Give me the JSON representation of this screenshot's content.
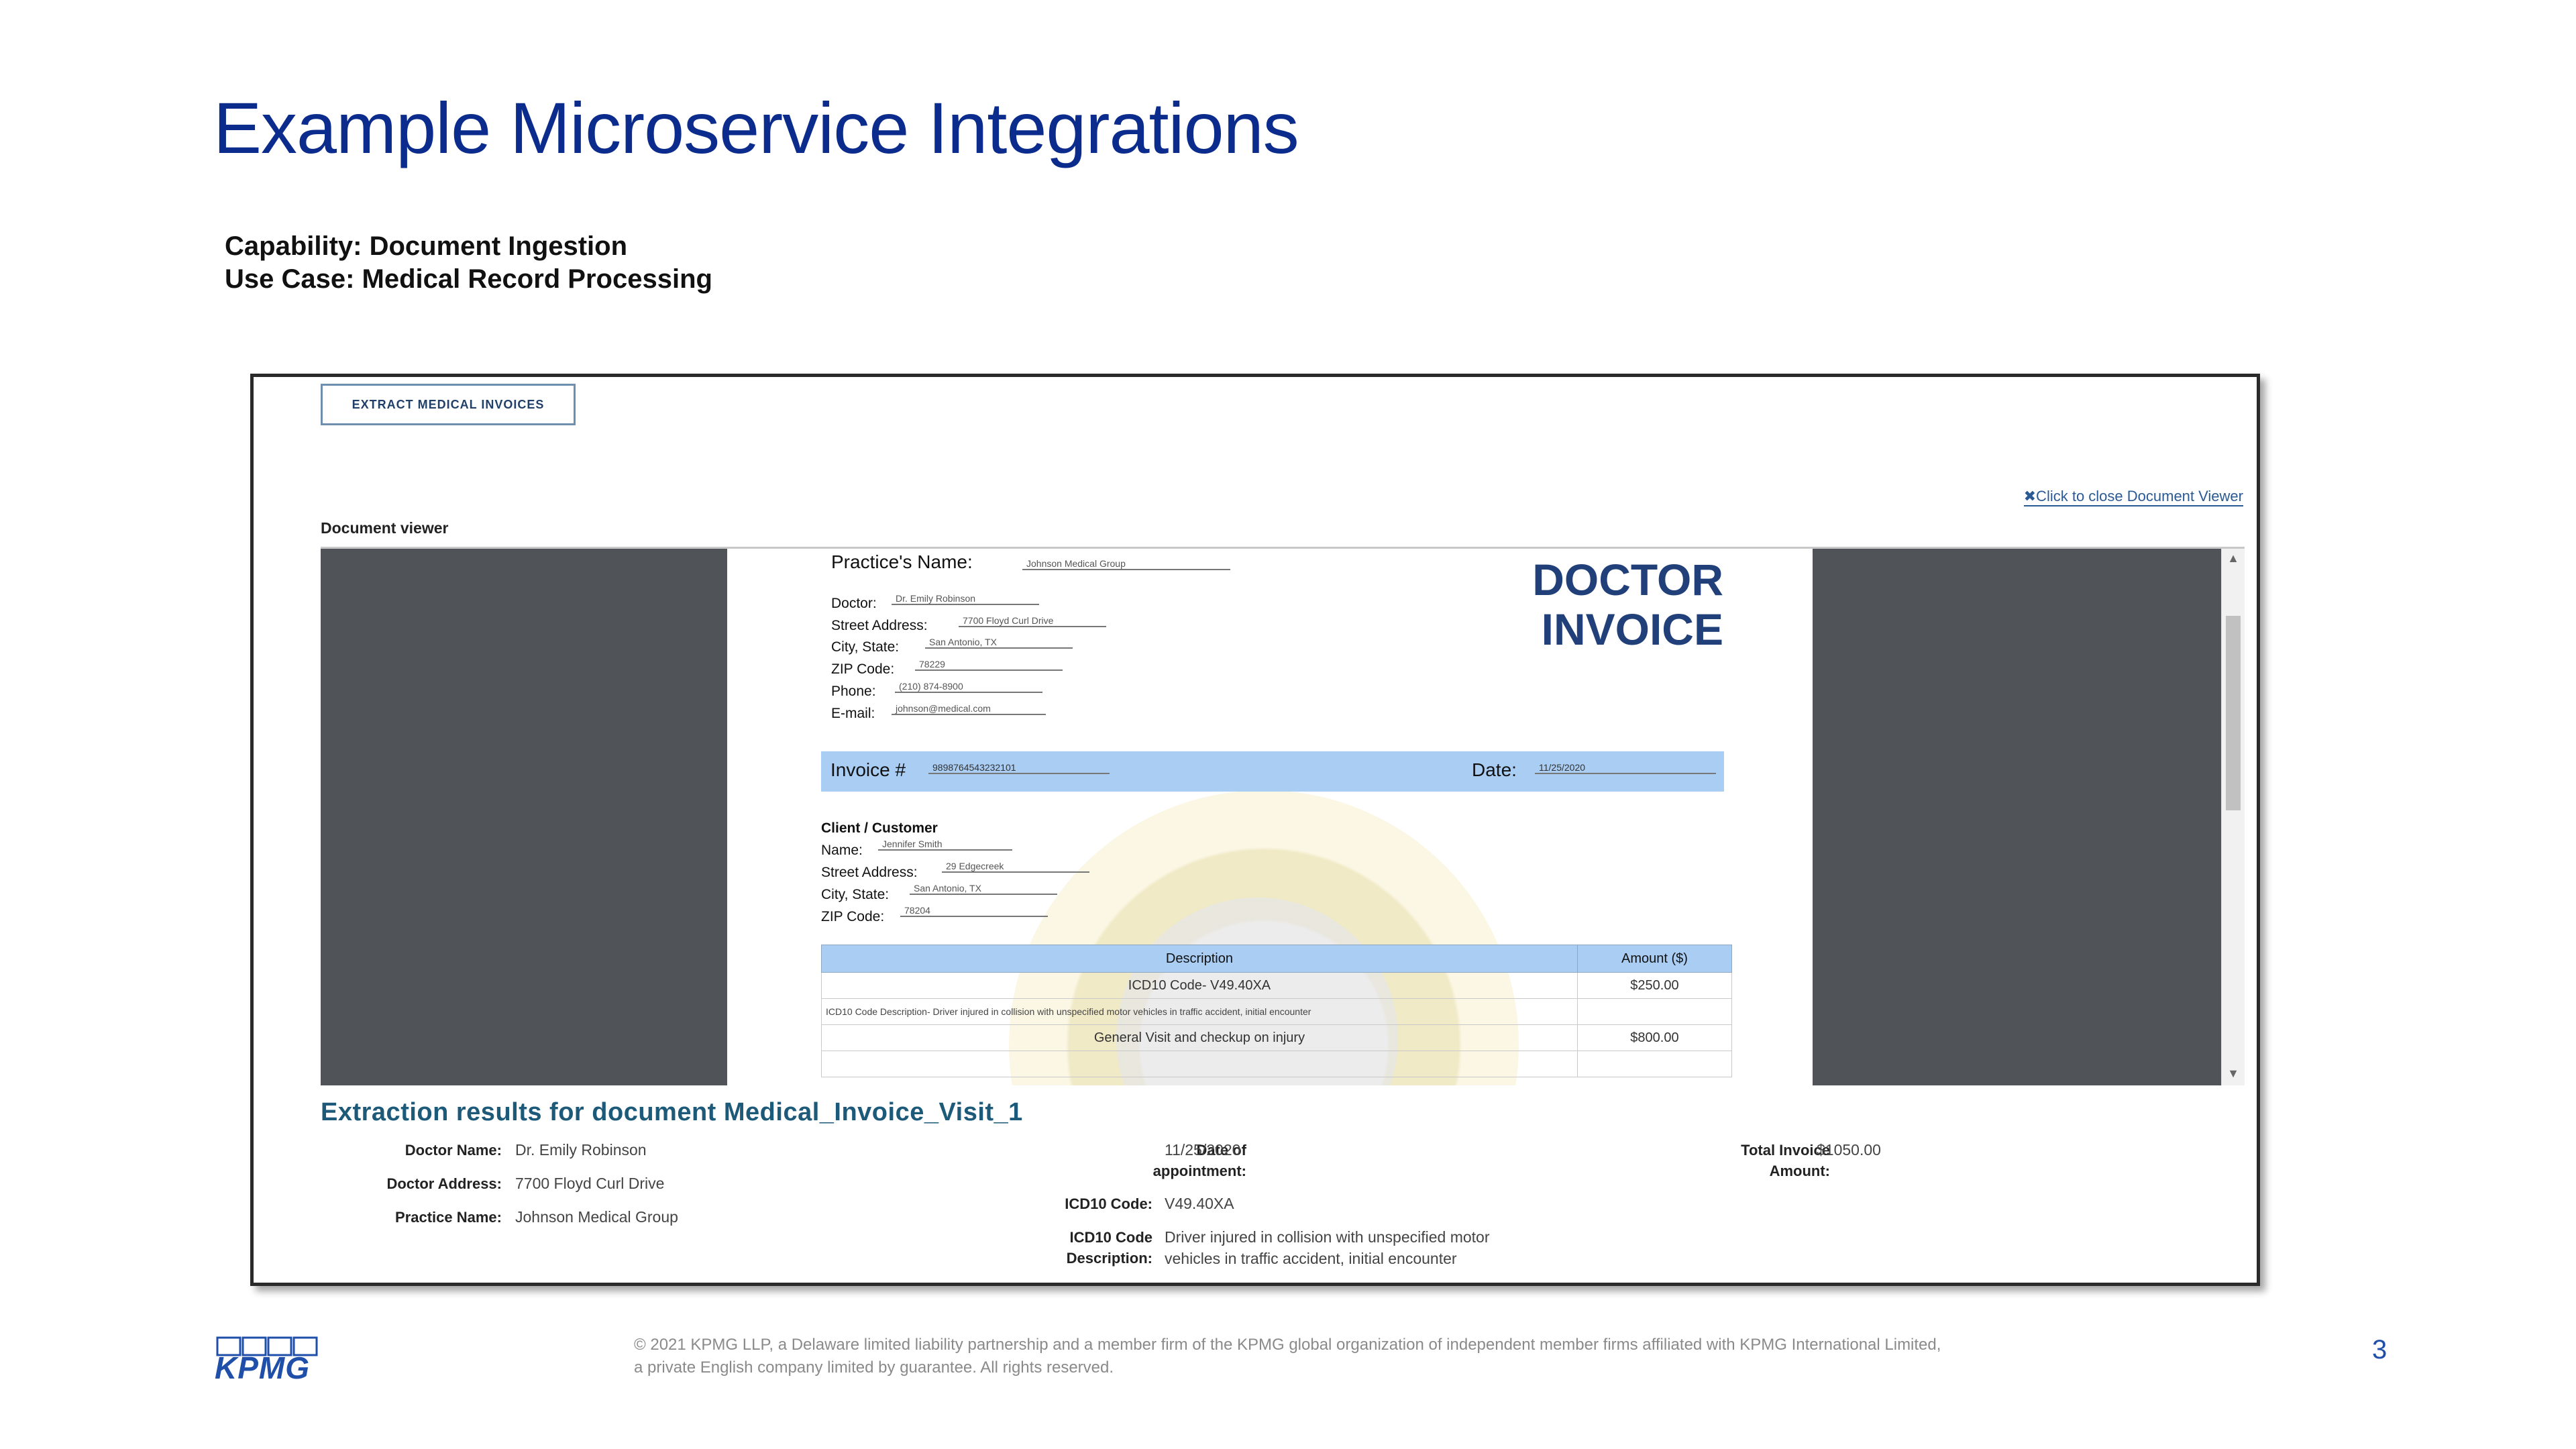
{
  "slide": {
    "title": "Example Microservice Integrations",
    "capability": "Capability: Document Ingestion",
    "use_case": "Use Case: Medical Record Processing"
  },
  "app": {
    "extract_button": "EXTRACT MEDICAL INVOICES",
    "close_viewer": "✖Click to close Document Viewer",
    "viewer_label": "Document viewer"
  },
  "invoice": {
    "heading_line1": "DOCTOR",
    "heading_line2": "INVOICE",
    "practice_label": "Practice's Name:",
    "practice_value": "Johnson Medical Group",
    "doctor_label": "Doctor:",
    "doctor_value": "Dr. Emily Robinson",
    "street_label": "Street Address:",
    "street_value": "7700 Floyd Curl Drive",
    "city_label": "City, State:",
    "city_value": "San Antonio, TX",
    "zip_label": "ZIP Code:",
    "zip_value": "78229",
    "phone_label": "Phone:",
    "phone_value": "(210) 874-8900",
    "email_label": "E-mail:",
    "email_value": "johnson@medical.com",
    "invoice_label": "Invoice #",
    "invoice_value": "9898764543232101",
    "date_label": "Date:",
    "date_value": "11/25/2020",
    "client_heading": "Client / Customer",
    "client_name_label": "Name:",
    "client_name_value": "Jennifer Smith",
    "client_street_label": "Street Address:",
    "client_street_value": "29 Edgecreek",
    "client_city_label": "City, State:",
    "client_city_value": "San Antonio, TX",
    "client_zip_label": "ZIP Code:",
    "client_zip_value": "78204",
    "table_headers": [
      "Description",
      "Amount ($)"
    ],
    "rows": [
      {
        "description": "ICD10 Code- V49.40XA",
        "amount": "$250.00"
      },
      {
        "description": "ICD10 Code Description- Driver injured in collision with unspecified motor vehicles in traffic accident, initial encounter",
        "amount": ""
      },
      {
        "description": "General Visit and checkup on injury",
        "amount": "$800.00"
      },
      {
        "description": "",
        "amount": ""
      }
    ]
  },
  "results": {
    "title": "Extraction results for document Medical_Invoice_Visit_1",
    "doctor_name_label": "Doctor Name:",
    "doctor_name_value": "Dr. Emily Robinson",
    "doctor_address_label": "Doctor Address:",
    "doctor_address_value": "7700 Floyd Curl Drive",
    "practice_name_label": "Practice Name:",
    "practice_name_value": "Johnson Medical Group",
    "date_label_1": "Date of",
    "date_label_2": "appointment:",
    "date_value": "11/25/2020",
    "icd_code_label": "ICD10 Code:",
    "icd_code_value": "V49.40XA",
    "icd_desc_label_1": "ICD10 Code",
    "icd_desc_label_2": "Description:",
    "icd_desc_value_1": "Driver injured in collision with unspecified motor",
    "icd_desc_value_2": "vehicles in traffic accident, initial encounter",
    "total_label_1": "Total Invoice",
    "total_label_2": "Amount:",
    "total_value": "$1050.00"
  },
  "footer": {
    "copyright_line1": "© 2021 KPMG LLP, a Delaware limited liability partnership and a member firm of the KPMG global organization of independent member firms affiliated with KPMG International Limited,",
    "copyright_line2": "a private English company limited by guarantee. All rights reserved.",
    "page_number": "3",
    "logo_text": "KPMG"
  },
  "colors": {
    "title_blue": "#0b2c8c",
    "invoice_bar": "#a9cdf3",
    "dark_panel": "#505458",
    "results_title": "#1d5a7a"
  }
}
